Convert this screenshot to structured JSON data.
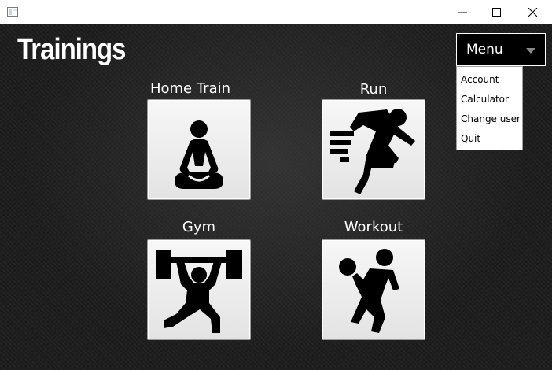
{
  "window": {
    "icon": "app-window-icon",
    "controls": [
      "minimize-icon",
      "maximize-icon",
      "close-icon"
    ]
  },
  "page": {
    "title": "Trainings"
  },
  "tiles": [
    {
      "label": "Home Train",
      "icon": "meditation-pose-icon"
    },
    {
      "label": "Run",
      "icon": "running-person-icon"
    },
    {
      "label": "Gym",
      "icon": "weightlifter-icon"
    },
    {
      "label": "Workout",
      "icon": "basketball-player-icon"
    }
  ],
  "menu": {
    "label": "Menu",
    "arrow_icon": "dropdown-arrow-icon",
    "items": [
      "Account",
      "Calculator",
      "Change user",
      "Quit"
    ]
  },
  "colors": {
    "background": "#1e1e1e",
    "tile": "#eeeeee",
    "title_text": "#ffffff",
    "menu_box": "#000000"
  }
}
